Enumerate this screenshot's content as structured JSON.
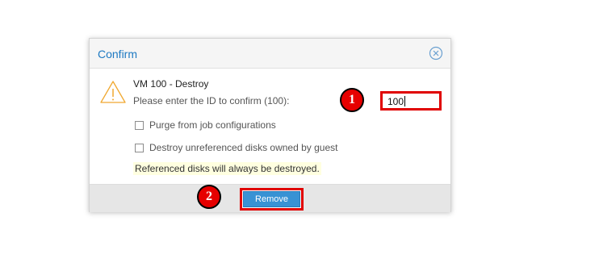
{
  "dialog": {
    "title": "Confirm",
    "heading": "VM 100 - Destroy",
    "prompt": "Please enter the ID to confirm (100):",
    "id_input_value": "100",
    "options": [
      {
        "label": "Purge from job configurations",
        "checked": false
      },
      {
        "label": "Destroy unreferenced disks owned by guest",
        "checked": false
      }
    ],
    "note": "Referenced disks will always be destroyed.",
    "remove_label": "Remove"
  },
  "annotations": {
    "step1": "1",
    "step2": "2"
  },
  "colors": {
    "title": "#1d79c2",
    "highlight_border": "#e00000",
    "button": "#3892d4",
    "note_bg": "#ffffe0",
    "badge": "#e60000"
  },
  "icons": {
    "close": "close-circle-icon",
    "warning": "warning-triangle-icon"
  }
}
